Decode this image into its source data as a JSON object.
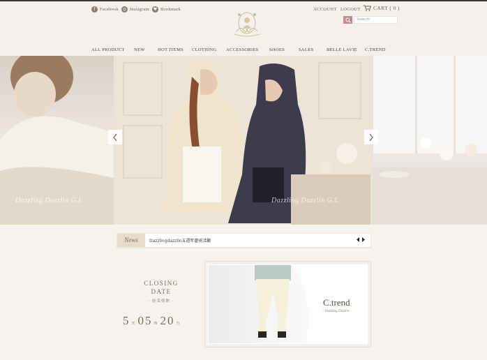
{
  "header": {
    "social": [
      {
        "label": "Facebook",
        "icon": "facebook-icon"
      },
      {
        "label": "Instagram",
        "icon": "instagram-icon"
      },
      {
        "label": "Bookmark",
        "icon": "bookmark-icon"
      }
    ],
    "account": "ACCOUNT",
    "logout": "LOGOUT",
    "cart": "CART ( 0 )",
    "search_placeholder": "Search"
  },
  "nav": [
    "ALL PRODUCT",
    "NEW",
    "HOT ITEMS",
    "CLOTHING",
    "ACCESSORIES",
    "SHOES",
    "SALES",
    "BELLE LAVIE",
    "C.TREND"
  ],
  "hero": {
    "watermark": "Dazzling Dazzlin G.L"
  },
  "news": {
    "tag": "News",
    "text": "Dazzlingdazzlin五週年慶祝活動"
  },
  "closing": {
    "title1": "CLOSING",
    "title2": "DATE",
    "subtitle": "- 結束倒數 -",
    "days": "5",
    "days_unit": "天",
    "hours": "05",
    "hours_unit": "時",
    "minutes": "20",
    "minutes_unit": "分"
  },
  "promo": {
    "title": "C.trend",
    "subtitle": "- Dazzling Dazzlin -"
  },
  "colors": {
    "accent": "#c88b93",
    "text": "#5a4d42",
    "bg": "#f6f3ef"
  }
}
